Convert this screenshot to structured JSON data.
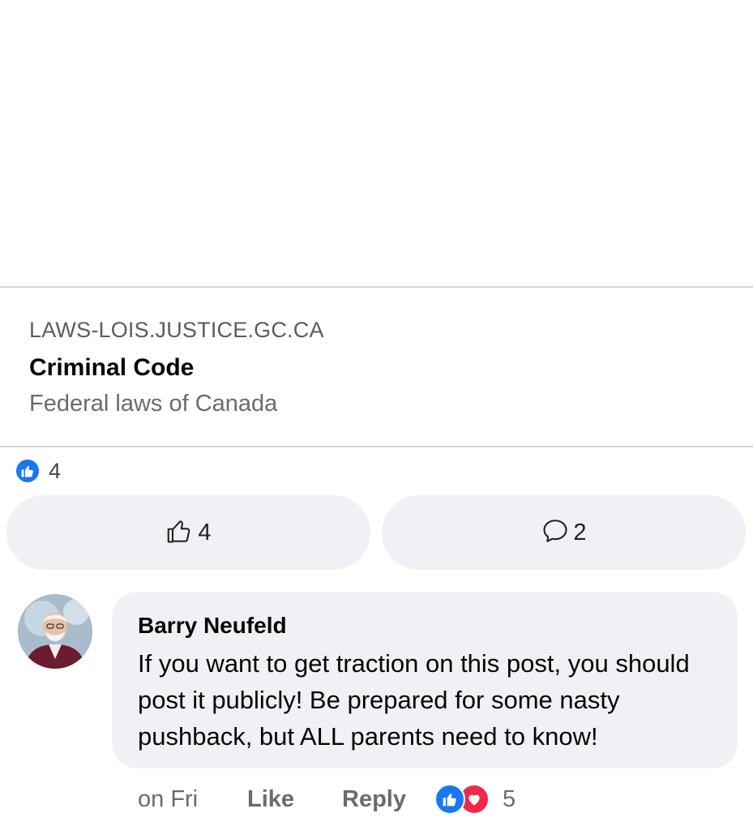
{
  "link_preview": {
    "domain": "LAWS-LOIS.JUSTICE.GC.CA",
    "title": "Criminal Code",
    "description": "Federal laws of Canada"
  },
  "reactions_summary": {
    "count": "4",
    "icon": "like-reaction-icon"
  },
  "actions": {
    "like_count": "4",
    "like_icon": "thumbs-up-outline-icon",
    "comment_count": "2",
    "comment_icon": "comment-bubble-icon"
  },
  "comment": {
    "author": "Barry Neufeld",
    "text": "If you want to get traction on this post, you should post it publicly! Be prepared for some nasty pushback, but ALL parents need to know!",
    "time": "on Fri",
    "like_label": "Like",
    "reply_label": "Reply",
    "reaction_count": "5",
    "reaction_icons": [
      "like-reaction-icon",
      "love-reaction-icon"
    ]
  },
  "colors": {
    "accent_blue": "#1a77f2",
    "love_red": "#f02849",
    "bubble_gray": "#f0f1f4"
  }
}
